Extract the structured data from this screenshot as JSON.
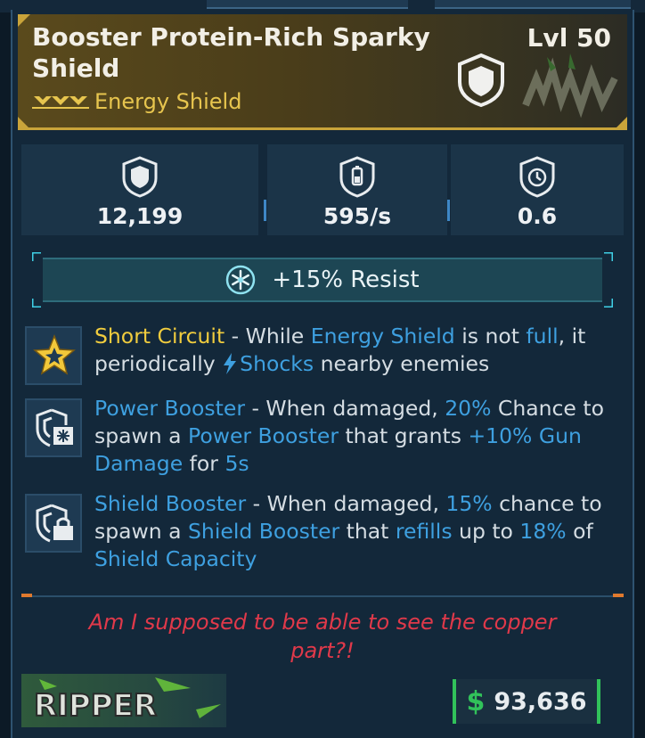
{
  "item": {
    "name": "Booster Protein-Rich Sparky Shield",
    "level": "Lvl 50",
    "type": "Energy Shield",
    "rarity_icon": "rarity-chevrons-icon",
    "type_icon": "shield-badge-icon"
  },
  "stats": [
    {
      "icon": "shield-capacity-icon",
      "value": "12,199"
    },
    {
      "icon": "recharge-rate-icon",
      "value": "595/s"
    },
    {
      "icon": "recharge-delay-icon",
      "value": "0.6"
    }
  ],
  "resist": {
    "icon": "cryo-snowflake-icon",
    "label": "+15% Resist"
  },
  "perks": [
    {
      "icon": "star-burst-icon",
      "segments": [
        {
          "t": "Short Circuit",
          "c": "y"
        },
        {
          "t": " - While ",
          "c": ""
        },
        {
          "t": "Energy Shield",
          "c": "b"
        },
        {
          "t": " is not ",
          "c": ""
        },
        {
          "t": "full",
          "c": "b"
        },
        {
          "t": ", it periodically ",
          "c": ""
        },
        {
          "t": "Shocks",
          "c": "b",
          "bolt": true
        },
        {
          "t": " nearby enemies",
          "c": ""
        }
      ]
    },
    {
      "icon": "shield-booster-plus-icon",
      "segments": [
        {
          "t": "Power Booster",
          "c": "b"
        },
        {
          "t": " - When damaged, ",
          "c": ""
        },
        {
          "t": "20%",
          "c": "b"
        },
        {
          "t": " Chance to spawn a ",
          "c": ""
        },
        {
          "t": "Power Booster",
          "c": "b"
        },
        {
          "t": " that grants ",
          "c": ""
        },
        {
          "t": "+10% Gun Damage",
          "c": "b"
        },
        {
          "t": " for ",
          "c": ""
        },
        {
          "t": "5s",
          "c": "b"
        }
      ]
    },
    {
      "icon": "shield-booster-lock-icon",
      "segments": [
        {
          "t": "Shield Booster",
          "c": "b"
        },
        {
          "t": " - When damaged, ",
          "c": ""
        },
        {
          "t": "15%",
          "c": "b"
        },
        {
          "t": " chance to spawn a ",
          "c": ""
        },
        {
          "t": "Shield Booster",
          "c": "b"
        },
        {
          "t": " that ",
          "c": ""
        },
        {
          "t": "refills",
          "c": "b"
        },
        {
          "t": " up to ",
          "c": ""
        },
        {
          "t": "18%",
          "c": "b"
        },
        {
          "t": " of ",
          "c": ""
        },
        {
          "t": "Shield Capacity",
          "c": "b"
        }
      ]
    }
  ],
  "flavor": "Am I supposed to be able to see the copper part?!",
  "manufacturer": {
    "logo_icon": "ripper-logo-icon",
    "logo_text": "RIPPER"
  },
  "price": {
    "currency": "$",
    "amount": "93,636"
  },
  "colors": {
    "highlight_yellow": "#f0cc3e",
    "highlight_blue": "#3ea0e0",
    "flavor_red": "#e0394a",
    "price_green": "#31c25a",
    "rarity_gold": "#c9a43a"
  }
}
